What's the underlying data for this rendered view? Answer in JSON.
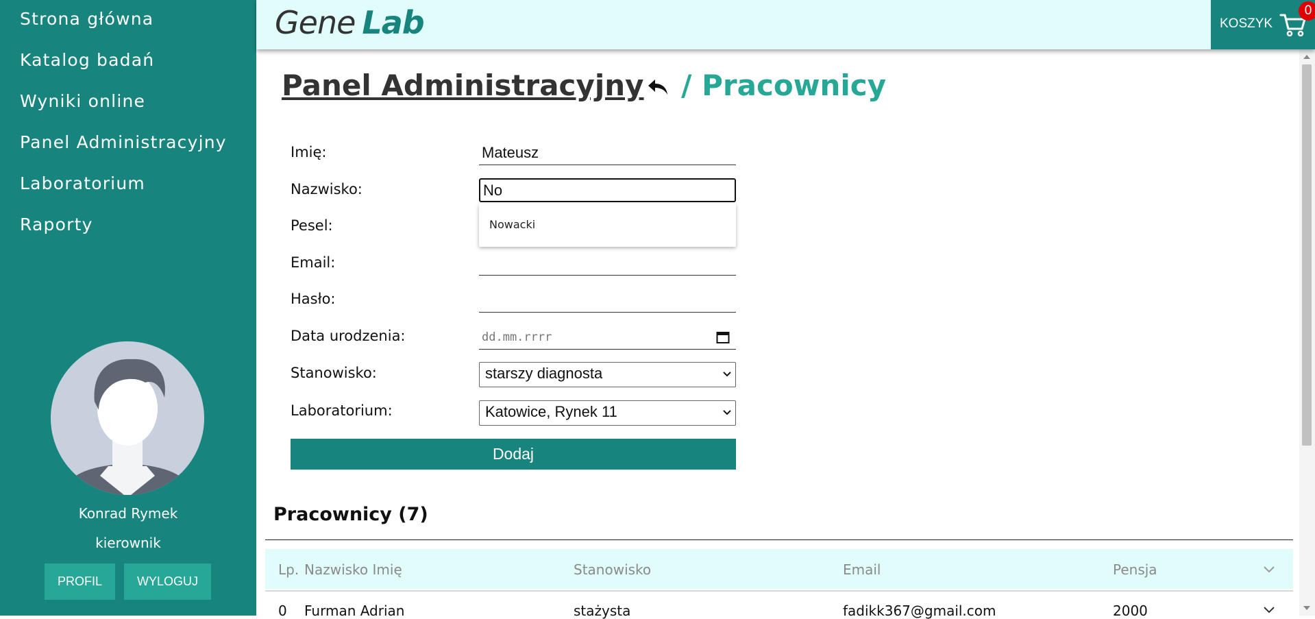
{
  "sidebar": {
    "nav": [
      "Strona główna",
      "Katalog badań",
      "Wyniki online",
      "Panel Administracyjny",
      "Laboratorium",
      "Raporty"
    ],
    "user": {
      "name": "Konrad Rymek",
      "role": "kierownik"
    },
    "buttons": {
      "profile": "PROFIL",
      "logout": "WYLOGUJ"
    }
  },
  "header": {
    "logo": {
      "gene": "Gene",
      "lab": "Lab"
    },
    "cart": {
      "label": "KOSZYK",
      "count": "0"
    }
  },
  "page": {
    "breadcrumb": {
      "parent": "Panel Administracyjny",
      "separator": "/",
      "current": "Pracownicy"
    }
  },
  "form": {
    "labels": {
      "first_name": "Imię:",
      "last_name": "Nazwisko:",
      "pesel": "Pesel:",
      "email": "Email:",
      "password": "Hasło:",
      "birth_date": "Data urodzenia:",
      "position": "Stanowisko:",
      "laboratory": "Laboratorium:"
    },
    "values": {
      "first_name": "Mateusz",
      "last_name": "No",
      "pesel": "",
      "email": "",
      "password": "",
      "birth_date_placeholder": "dd.mm.rrrr",
      "position": "starszy diagnosta",
      "laboratory": "Katowice, Rynek 11"
    },
    "autocomplete": [
      "Nowacki"
    ],
    "submit": "Dodaj"
  },
  "employees": {
    "title": "Pracownicy (7)",
    "columns": [
      "Lp.",
      "Nazwisko Imię",
      "Stanowisko",
      "Email",
      "Pensja"
    ],
    "rows": [
      {
        "lp": "0",
        "name": "Furman Adrian",
        "position": "stażysta",
        "email": "fadikk367@gmail.com",
        "salary": "2000"
      }
    ]
  },
  "colors": {
    "accent": "#17857d",
    "accent_light": "#27a896",
    "header_bg": "#e0fdfc",
    "badge": "#e00000"
  }
}
